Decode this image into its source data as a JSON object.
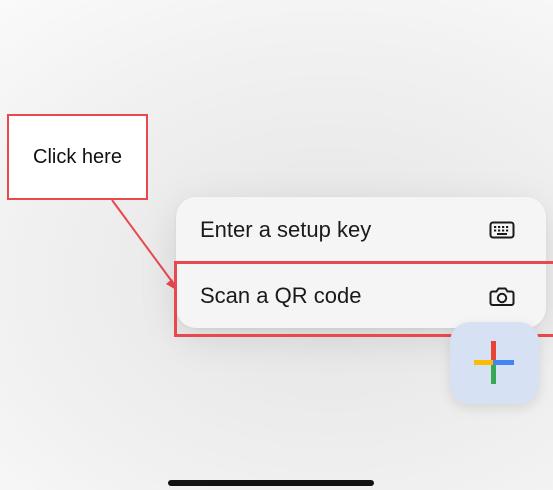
{
  "callout": {
    "text": "Click here",
    "border_color": "#e8494f"
  },
  "menu": {
    "items": [
      {
        "label": "Enter a setup key",
        "icon": "keyboard-icon"
      },
      {
        "label": "Scan a QR code",
        "icon": "camera-icon"
      }
    ]
  },
  "fab": {
    "icon": "plus-icon",
    "colors": {
      "top": "#ea4335",
      "left": "#fbbc04",
      "right": "#4285f4",
      "bottom": "#34a853",
      "background": "#d6e1f3"
    }
  },
  "highlight_color": "#e8494f"
}
